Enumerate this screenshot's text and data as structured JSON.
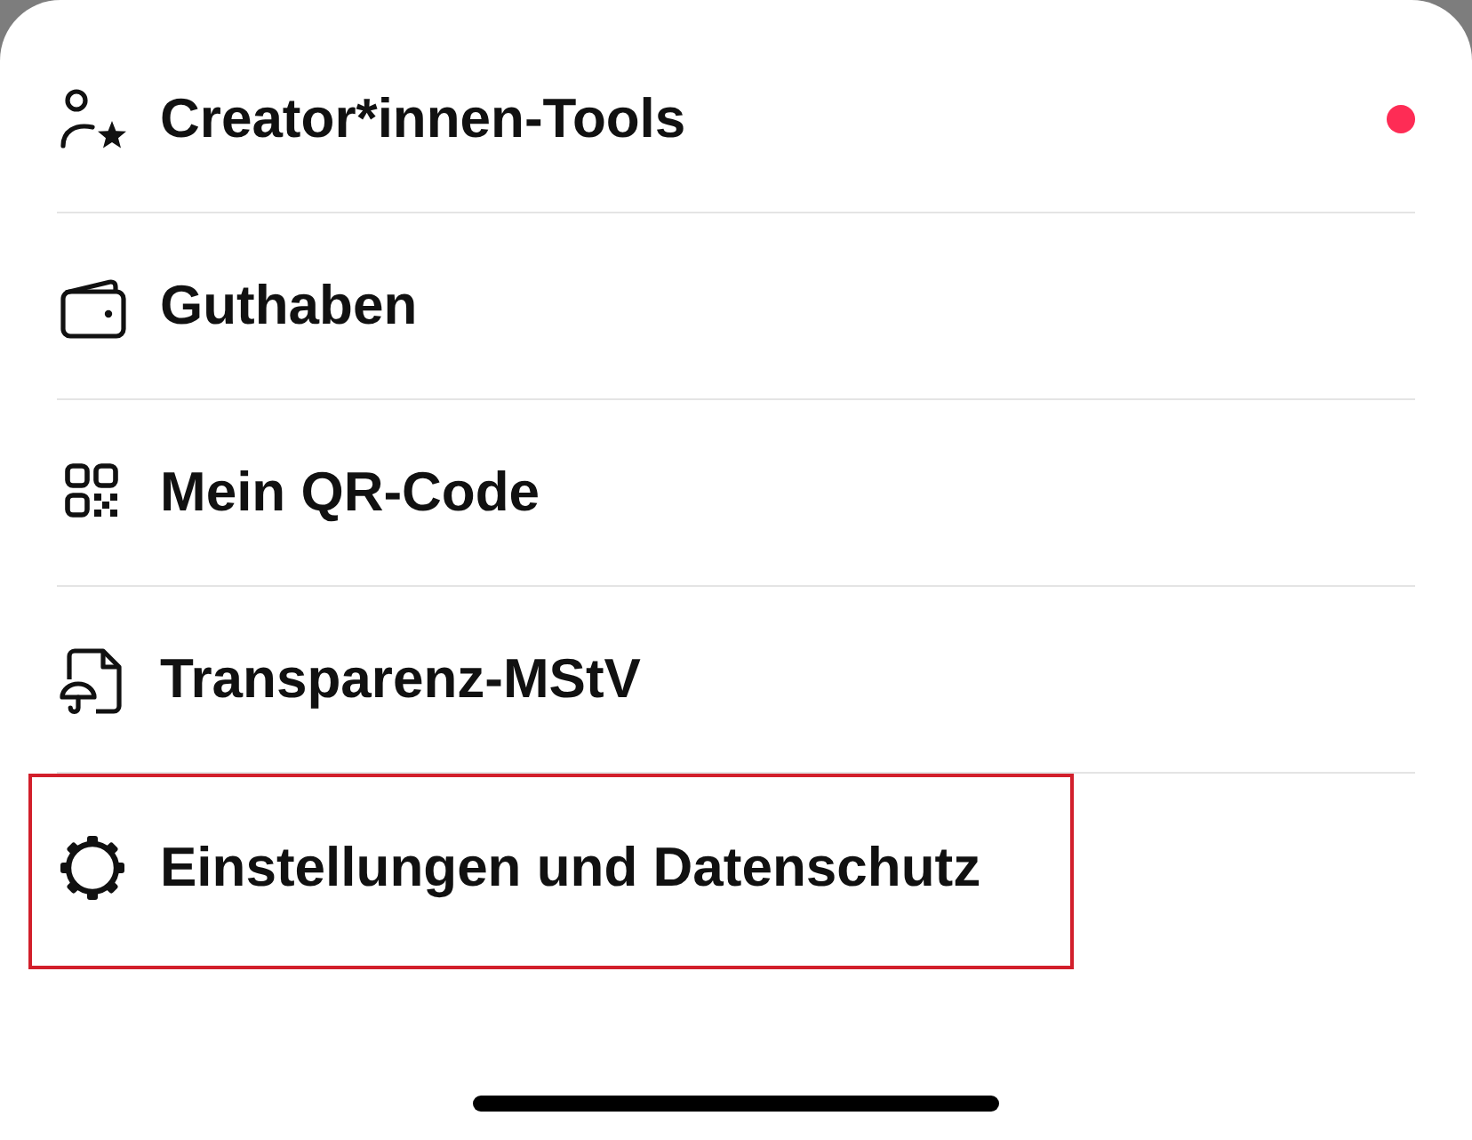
{
  "menu": {
    "items": [
      {
        "kind": "creator",
        "label": "Creator*innen-Tools",
        "notification": true,
        "highlighted": false
      },
      {
        "kind": "wallet",
        "label": "Guthaben",
        "notification": false,
        "highlighted": false
      },
      {
        "kind": "qr",
        "label": "Mein QR-Code",
        "notification": false,
        "highlighted": false
      },
      {
        "kind": "document",
        "label": "Transparenz-MStV",
        "notification": false,
        "highlighted": false
      },
      {
        "kind": "settings",
        "label": "Einstellungen und Datenschutz",
        "notification": false,
        "highlighted": true
      }
    ]
  }
}
